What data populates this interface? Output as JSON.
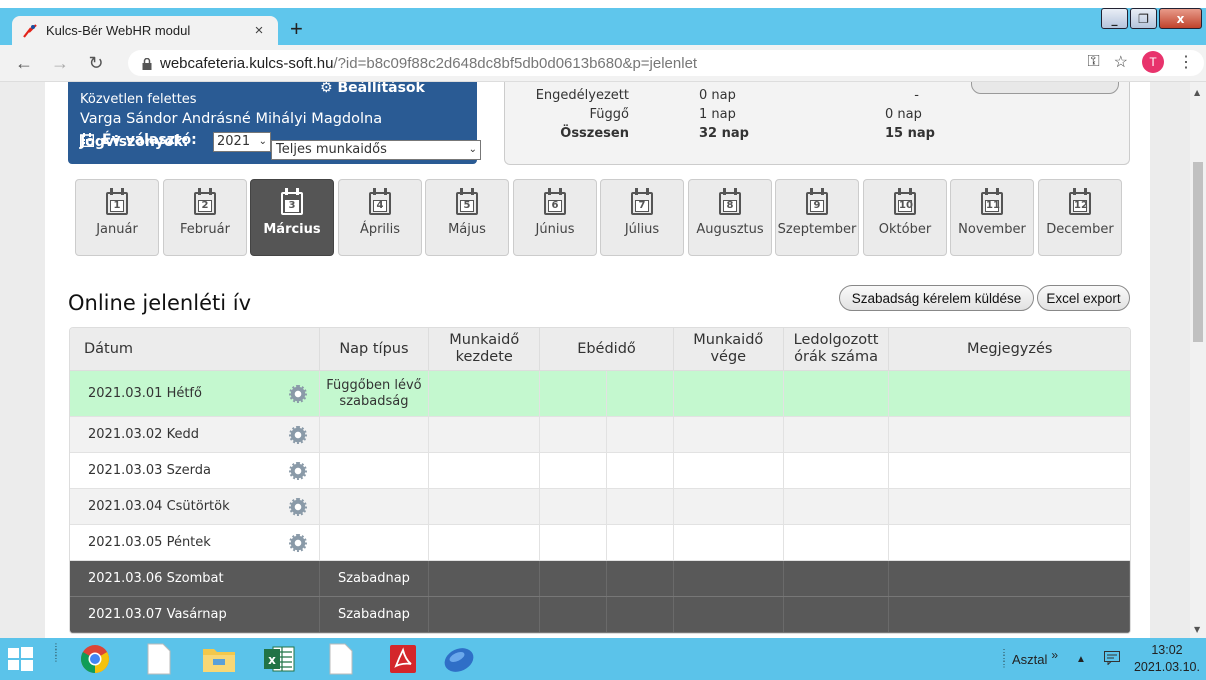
{
  "browser": {
    "tab_title": "Kulcs-Bér WebHR modul",
    "tab_close": "×",
    "new_tab": "+",
    "url_host": "webcafeteria.kulcs-soft.hu",
    "url_path": "/?id=b8c09f88c2d648dc8bf5db0d0613b680&p=jelenlet",
    "profile_initial": "T",
    "window_buttons": [
      "_",
      "❐",
      "x"
    ]
  },
  "header": {
    "settings_label": "Beállítások",
    "supervisor_label": "Közvetlen felettes",
    "supervisor_name": "Varga Sándor Andrásné Mihályi Magdolna",
    "jogviszony_label": "Jogviszonyok:",
    "year_label": "Év választó:",
    "year_value": "2021",
    "type_value": "Teljes munkaidős"
  },
  "stats": [
    {
      "label": "Engedélyezett",
      "v1": "0 nap",
      "v2": "-",
      "bold": false
    },
    {
      "label": "Függő",
      "v1": "1 nap",
      "v2": "0 nap",
      "bold": false
    },
    {
      "label": "Összesen",
      "v1": "32 nap",
      "v2": "15 nap",
      "bold": true
    }
  ],
  "months": [
    {
      "num": "1",
      "label": "Január"
    },
    {
      "num": "2",
      "label": "Február"
    },
    {
      "num": "3",
      "label": "Március",
      "active": true
    },
    {
      "num": "4",
      "label": "Április"
    },
    {
      "num": "5",
      "label": "Május"
    },
    {
      "num": "6",
      "label": "Június"
    },
    {
      "num": "7",
      "label": "Július"
    },
    {
      "num": "8",
      "label": "Augusztus"
    },
    {
      "num": "9",
      "label": "Szeptember"
    },
    {
      "num": "10",
      "label": "Október"
    },
    {
      "num": "11",
      "label": "November"
    },
    {
      "num": "12",
      "label": "December"
    }
  ],
  "section": {
    "title": "Online jelenléti ív",
    "leave_button": "Szabadság kérelem küldése",
    "export_button": "Excel export"
  },
  "table": {
    "headers": {
      "date": "Dátum",
      "day_type": "Nap típus",
      "start": "Munkaidő kezdete",
      "lunch": "Ebédidő",
      "end": "Munkaidő vége",
      "hours": "Ledolgozott órák száma",
      "note": "Megjegyzés"
    },
    "rows": [
      {
        "date": "2021.03.01 Hétfő",
        "type": "Függőben lévő szabadság",
        "style": "pending",
        "gear": true
      },
      {
        "date": "2021.03.02 Kedd",
        "type": "",
        "style": "gray",
        "gear": true
      },
      {
        "date": "2021.03.03 Szerda",
        "type": "",
        "style": "white",
        "gear": true
      },
      {
        "date": "2021.03.04 Csütörtök",
        "type": "",
        "style": "gray",
        "gear": true
      },
      {
        "date": "2021.03.05 Péntek",
        "type": "",
        "style": "white",
        "gear": true
      },
      {
        "date": "2021.03.06 Szombat",
        "type": "Szabadnap",
        "style": "weekend",
        "gear": false
      },
      {
        "date": "2021.03.07 Vasárnap",
        "type": "Szabadnap",
        "style": "weekend",
        "gear": false
      }
    ]
  },
  "taskbar": {
    "desktop_label": "Asztal",
    "chevron": "»",
    "time": "13:02",
    "date": "2021.03.10."
  },
  "colors": {
    "accent_blue": "#2a5b94",
    "pending_green": "#c4f8cf",
    "weekend_gray": "#595959",
    "taskbar": "#5bc3ea"
  }
}
